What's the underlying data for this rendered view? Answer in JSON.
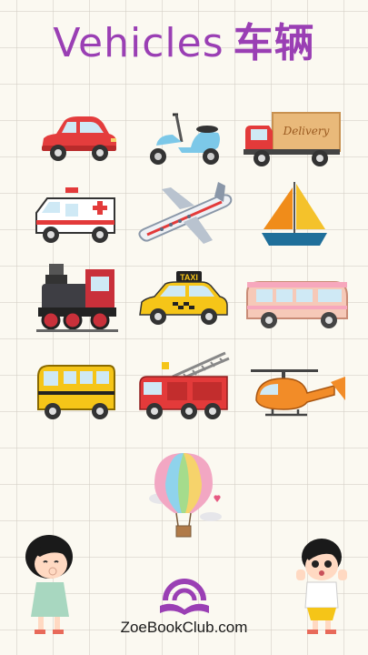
{
  "title": {
    "main": "Vehicles",
    "chinese": "车辆"
  },
  "vehicles": [
    {
      "name": "car"
    },
    {
      "name": "scooter"
    },
    {
      "name": "truck",
      "side_text": "Delivery"
    },
    {
      "name": "ambulance"
    },
    {
      "name": "airplane"
    },
    {
      "name": "sailboat"
    },
    {
      "name": "train"
    },
    {
      "name": "taxi",
      "sign_text": "TAXI"
    },
    {
      "name": "camper-van"
    },
    {
      "name": "school-bus"
    },
    {
      "name": "fire-truck"
    },
    {
      "name": "helicopter"
    },
    {
      "name": "hot-air-balloon"
    }
  ],
  "footer": {
    "website": "ZoeBookClub.com"
  },
  "colors": {
    "title": "#9a3fb4",
    "logo": "#9a3fb4",
    "background": "#fbf9f1"
  }
}
